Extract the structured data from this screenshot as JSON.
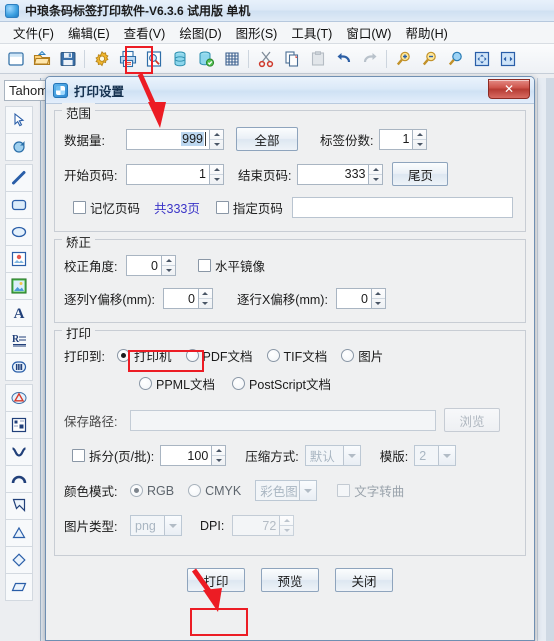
{
  "app": {
    "title": "中琅条码标签打印软件-V6.3.6 试用版 单机",
    "icon": "app-logo-icon",
    "menus": [
      "文件(F)",
      "编辑(E)",
      "查看(V)",
      "绘图(D)",
      "图形(S)",
      "工具(T)",
      "窗口(W)",
      "帮助(H)"
    ],
    "toolbar_icons": [
      "new-document-icon",
      "open-folder-icon",
      "save-icon",
      "sep",
      "settings-gear-icon",
      "print-icon",
      "print-preview-icon",
      "database-icon",
      "database-sync-icon",
      "grid-icon",
      "sep",
      "cut-icon",
      "copy-icon",
      "paste-icon",
      "undo-icon",
      "redo-icon",
      "sep",
      "zoom-in-icon",
      "zoom-out-icon",
      "zoom-actual-icon",
      "fit-page-icon",
      "fit-width-icon"
    ],
    "font_value": "Tahom",
    "palette_icons": [
      "select-arrow-icon",
      "rotate-icon",
      "sep",
      "line-icon",
      "rounded-rect-icon",
      "ellipse-icon",
      "barcode-image-icon",
      "picture-icon",
      "text-a-icon",
      "rich-text-icon",
      "barcode-icon",
      "sep",
      "warning-triangle-icon",
      "datamatrix-icon",
      "curve-icon",
      "arc-icon",
      "polygon-icon",
      "triangle-icon",
      "diamond-icon",
      "parallelogram-icon"
    ]
  },
  "dialog": {
    "title": "打印设置",
    "icon": "print-settings-icon",
    "close_label": "✕",
    "range": {
      "legend": "范围",
      "data_count_label": "数据量:",
      "data_count_value": "999",
      "all_button": "全部",
      "label_copies_label": "标签份数:",
      "label_copies_value": "1",
      "start_page_label": "开始页码:",
      "start_page_value": "1",
      "end_page_label": "结束页码:",
      "end_page_value": "333",
      "last_page_button": "尾页",
      "remember_page_label": "记忆页码",
      "remember_page_checked": false,
      "total_pages_link": "共333页",
      "specify_page_label": "指定页码",
      "specify_page_checked": false,
      "specify_page_value": ""
    },
    "correction": {
      "legend": "矫正",
      "angle_label": "校正角度:",
      "angle_value": "0",
      "mirror_label": "水平镜像",
      "mirror_checked": false,
      "offset_y_label": "逐列Y偏移(mm):",
      "offset_y_value": "0",
      "offset_x_label": "逐行X偏移(mm):",
      "offset_x_value": "0"
    },
    "print": {
      "legend": "打印",
      "print_to_label": "打印到:",
      "targets": [
        {
          "label": "打印机",
          "selected": true
        },
        {
          "label": "PDF文档",
          "selected": false
        },
        {
          "label": "TIF文档",
          "selected": false
        },
        {
          "label": "图片",
          "selected": false
        },
        {
          "label": "PPML文档",
          "selected": false
        },
        {
          "label": "PostScript文档",
          "selected": false
        }
      ],
      "save_path_label": "保存路径:",
      "save_path_value": "",
      "browse_button": "浏览",
      "split_label": "拆分(页/批):",
      "split_checked": false,
      "split_value": "100",
      "compress_label": "压缩方式:",
      "compress_value": "默认",
      "template_label": "模版:",
      "template_value": "2",
      "color_mode_label": "颜色模式:",
      "color_rgb_label": "RGB",
      "color_rgb_selected": true,
      "color_cmyk_label": "CMYK",
      "color_cmyk_selected": false,
      "color_image_value": "彩色图",
      "text_to_curve_label": "文字转曲",
      "text_to_curve_checked": false,
      "image_type_label": "图片类型:",
      "image_type_value": "png",
      "dpi_label": "DPI:",
      "dpi_value": "72"
    },
    "footer": {
      "print_button": "打印",
      "preview_button": "预览",
      "close_button": "关闭"
    }
  },
  "annotations": {
    "accent_color": "#ec1c24",
    "highlights": [
      "toolbar-print-icon",
      "printer-radio-option",
      "print-button"
    ]
  }
}
